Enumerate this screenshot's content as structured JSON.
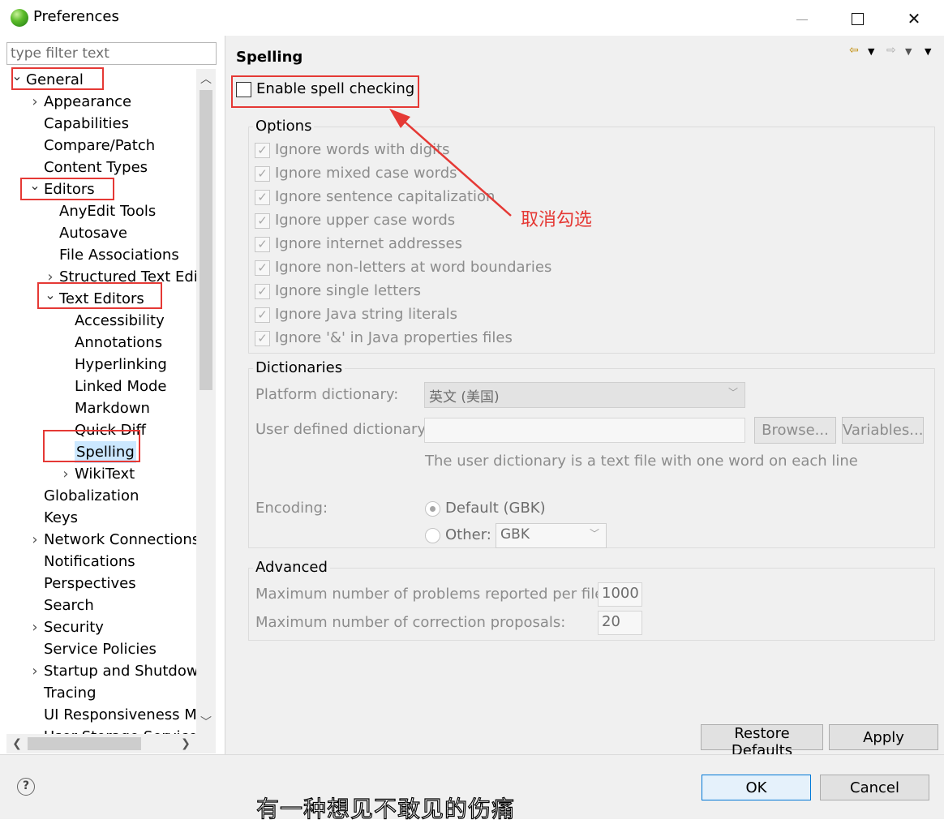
{
  "window": {
    "title": "Preferences",
    "minimize_glyph": "—",
    "close_glyph": "✕"
  },
  "sidebar": {
    "filter_placeholder": "type filter text",
    "items": [
      {
        "label": "General",
        "level": 0,
        "twisty": "expanded"
      },
      {
        "label": "Appearance",
        "level": 1,
        "twisty": "collapsed"
      },
      {
        "label": "Capabilities",
        "level": 1,
        "twisty": "none"
      },
      {
        "label": "Compare/Patch",
        "level": 1,
        "twisty": "none"
      },
      {
        "label": "Content Types",
        "level": 1,
        "twisty": "none"
      },
      {
        "label": "Editors",
        "level": 1,
        "twisty": "expanded"
      },
      {
        "label": "AnyEdit Tools",
        "level": 2,
        "twisty": "none"
      },
      {
        "label": "Autosave",
        "level": 2,
        "twisty": "none"
      },
      {
        "label": "File Associations",
        "level": 2,
        "twisty": "none"
      },
      {
        "label": "Structured Text Edit",
        "level": 2,
        "twisty": "collapsed"
      },
      {
        "label": "Text Editors",
        "level": 2,
        "twisty": "expanded"
      },
      {
        "label": "Accessibility",
        "level": 3,
        "twisty": "none"
      },
      {
        "label": "Annotations",
        "level": 3,
        "twisty": "none"
      },
      {
        "label": "Hyperlinking",
        "level": 3,
        "twisty": "none"
      },
      {
        "label": "Linked Mode",
        "level": 3,
        "twisty": "none"
      },
      {
        "label": "Markdown",
        "level": 3,
        "twisty": "none"
      },
      {
        "label": "Quick Diff",
        "level": 3,
        "twisty": "none"
      },
      {
        "label": "Spelling",
        "level": 3,
        "twisty": "none",
        "selected": true
      },
      {
        "label": "WikiText",
        "level": 3,
        "twisty": "collapsed"
      },
      {
        "label": "Globalization",
        "level": 1,
        "twisty": "none"
      },
      {
        "label": "Keys",
        "level": 1,
        "twisty": "none"
      },
      {
        "label": "Network Connections",
        "level": 1,
        "twisty": "collapsed"
      },
      {
        "label": "Notifications",
        "level": 1,
        "twisty": "none"
      },
      {
        "label": "Perspectives",
        "level": 1,
        "twisty": "none"
      },
      {
        "label": "Search",
        "level": 1,
        "twisty": "none"
      },
      {
        "label": "Security",
        "level": 1,
        "twisty": "collapsed"
      },
      {
        "label": "Service Policies",
        "level": 1,
        "twisty": "none"
      },
      {
        "label": "Startup and Shutdowr",
        "level": 1,
        "twisty": "collapsed"
      },
      {
        "label": "Tracing",
        "level": 1,
        "twisty": "none"
      },
      {
        "label": "UI Responsiveness Mo",
        "level": 1,
        "twisty": "none"
      },
      {
        "label": "User Storage Service",
        "level": 1,
        "twisty": "none"
      }
    ]
  },
  "page": {
    "title": "Spelling",
    "enable_label": "Enable spell checking",
    "enable_checked": false,
    "options": {
      "title": "Options",
      "items": [
        {
          "label": "Ignore words with digits",
          "checked": true
        },
        {
          "label": "Ignore mixed case words",
          "checked": true
        },
        {
          "label": "Ignore sentence capitalization",
          "checked": true
        },
        {
          "label": "Ignore upper case words",
          "checked": true
        },
        {
          "label": "Ignore internet addresses",
          "checked": true
        },
        {
          "label": "Ignore non-letters at word boundaries",
          "checked": true
        },
        {
          "label": "Ignore single letters",
          "checked": true
        },
        {
          "label": "Ignore Java string literals",
          "checked": true
        },
        {
          "label": "Ignore '&' in Java properties files",
          "checked": true
        }
      ]
    },
    "dictionaries": {
      "title": "Dictionaries",
      "platform_label": "Platform dictionary:",
      "platform_value": "英文 (美国)",
      "user_label": "User defined dictionary:",
      "user_value": "",
      "browse_label": "Browse...",
      "variables_label": "Variables...",
      "hint": "The user dictionary is a text file with one word on each line",
      "encoding_label": "Encoding:",
      "default_label": "Default (GBK)",
      "other_label": "Other:",
      "other_value": "GBK"
    },
    "advanced": {
      "title": "Advanced",
      "max_problems_label": "Maximum number of problems reported per file:",
      "max_problems_value": "1000",
      "max_proposals_label": "Maximum number of correction proposals:",
      "max_proposals_value": "20"
    },
    "restore_defaults_label": "Restore Defaults",
    "apply_label": "Apply"
  },
  "footer": {
    "help_glyph": "?",
    "ok_label": "OK",
    "cancel_label": "Cancel"
  },
  "annotations": {
    "note": "取消勾选",
    "caption": "有一种想见不敢见的伤痛",
    "color": "#e53935"
  }
}
